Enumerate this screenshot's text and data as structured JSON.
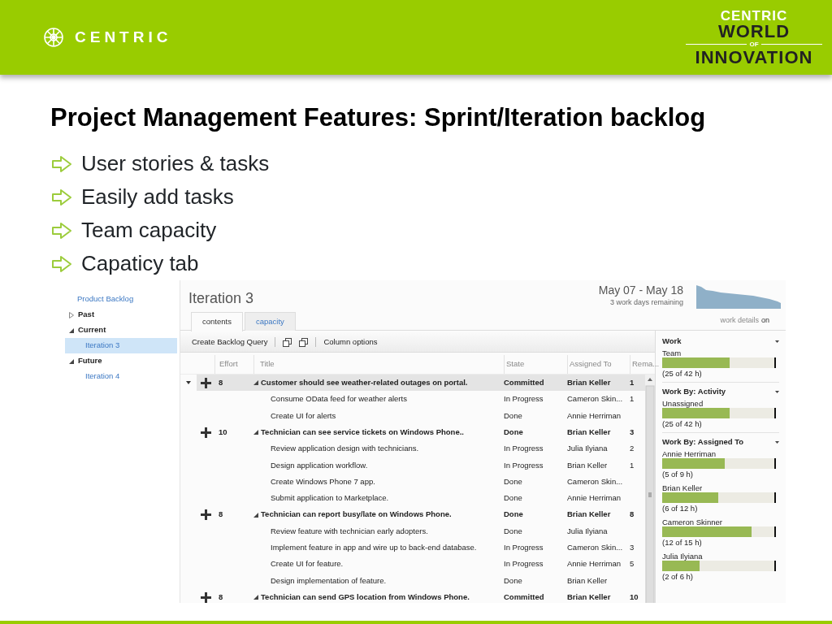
{
  "header": {
    "logo_text": "CENTRIC",
    "badge": {
      "top": "CENTRIC",
      "middle": "WORLD",
      "small": "OF",
      "bottom": "INNOVATION"
    }
  },
  "title": "Project Management Features: Sprint/Iteration backlog",
  "bullets": [
    "User stories & tasks",
    "Easily add tasks",
    "Team capacity",
    "Capaticy tab"
  ],
  "app": {
    "nav": [
      {
        "kind": "link",
        "label": "Product Backlog",
        "selected": false
      },
      {
        "kind": "group",
        "label": "Past",
        "expanded": false,
        "selected": false
      },
      {
        "kind": "group",
        "label": "Current",
        "expanded": true,
        "selected": false,
        "children": [
          {
            "label": "Iteration 3",
            "selected": true
          }
        ]
      },
      {
        "kind": "group",
        "label": "Future",
        "expanded": true,
        "selected": false,
        "children": [
          {
            "label": "Iteration 4",
            "selected": false
          }
        ]
      }
    ],
    "iteration": {
      "name": "Iteration 3",
      "dates": "May 07 - May 18",
      "days_remaining": "3 work days remaining"
    },
    "tabs": [
      {
        "label": "contents",
        "selected": true
      },
      {
        "label": "capacity",
        "selected": false
      }
    ],
    "work_details": {
      "label": "work details",
      "value": "on"
    },
    "toolbar": [
      {
        "kind": "text",
        "label": "Create Backlog Query"
      },
      {
        "kind": "separator"
      },
      {
        "kind": "icon"
      },
      {
        "kind": "icon"
      },
      {
        "kind": "separator"
      },
      {
        "kind": "text",
        "label": "Column options"
      }
    ],
    "table": {
      "columns": [
        "Effort",
        "Title",
        "State",
        "Assigned To",
        "Rema..."
      ],
      "rows": [
        {
          "kind": "story",
          "selected": true,
          "expanded": true,
          "effort": "8",
          "title": "Customer should see weather-related outages on portal.",
          "state": "Committed",
          "assigned_to": "Brian Keller",
          "remaining": "1"
        },
        {
          "kind": "task",
          "selected": false,
          "title": "Consume OData feed for weather alerts",
          "state": "In Progress",
          "assigned_to": "Cameron Skin...",
          "remaining": "1"
        },
        {
          "kind": "task",
          "selected": false,
          "title": "Create UI for alerts",
          "state": "Done",
          "assigned_to": "Annie Herriman"
        },
        {
          "kind": "story",
          "selected": false,
          "expanded": true,
          "effort": "10",
          "title": "Technician can see service tickets on Windows Phone..",
          "state": "Done",
          "assigned_to": "Brian Keller",
          "remaining": "3"
        },
        {
          "kind": "task",
          "selected": false,
          "title": "Review application design with technicians.",
          "state": "In Progress",
          "assigned_to": "Julia Ilyiana",
          "remaining": "2"
        },
        {
          "kind": "task",
          "selected": false,
          "title": "Design application workflow.",
          "state": "In Progress",
          "assigned_to": "Brian Keller",
          "remaining": "1"
        },
        {
          "kind": "task",
          "selected": false,
          "title": "Create Windows Phone 7 app.",
          "state": "Done",
          "assigned_to": "Cameron Skin..."
        },
        {
          "kind": "task",
          "selected": false,
          "title": "Submit application to Marketplace.",
          "state": "Done",
          "assigned_to": "Annie Herriman"
        },
        {
          "kind": "story",
          "selected": false,
          "expanded": true,
          "effort": "8",
          "title": "Technician can report busy/late on Windows Phone.",
          "state": "Done",
          "assigned_to": "Brian Keller",
          "remaining": "8"
        },
        {
          "kind": "task",
          "selected": false,
          "title": "Review feature with technician early adopters.",
          "state": "Done",
          "assigned_to": "Julia Ilyiana"
        },
        {
          "kind": "task",
          "selected": false,
          "title": "Implement feature in app and wire up to back-end database.",
          "state": "In Progress",
          "assigned_to": "Cameron Skin...",
          "remaining": "3"
        },
        {
          "kind": "task",
          "selected": false,
          "title": "Create UI for feature.",
          "state": "In Progress",
          "assigned_to": "Annie Herriman",
          "remaining": "5"
        },
        {
          "kind": "task",
          "selected": false,
          "title": "Design implementation of feature.",
          "state": "Done",
          "assigned_to": "Brian Keller"
        },
        {
          "kind": "story",
          "selected": false,
          "expanded": true,
          "effort": "8",
          "title": "Technician can send GPS location from Windows Phone.",
          "state": "Committed",
          "assigned_to": "Brian Keller",
          "remaining": "10"
        }
      ]
    },
    "capacity": {
      "sections": [
        {
          "title": "Work",
          "items": [
            {
              "name": "Team",
              "level": 0.6,
              "reading": "(25 of 42 h)"
            }
          ]
        },
        {
          "title": "Work By: Activity",
          "items": [
            {
              "name": "Unassigned",
              "level": 0.6,
              "reading": "(25 of 42 h)"
            }
          ]
        },
        {
          "title": "Work By: Assigned To",
          "items": [
            {
              "name": "Annie Herriman",
              "level": 0.56,
              "reading": "(5 of 9 h)"
            },
            {
              "name": "Brian Keller",
              "level": 0.5,
              "reading": "(6 of 12 h)"
            },
            {
              "name": "Cameron Skinner",
              "level": 0.8,
              "reading": "(12 of 15 h)"
            },
            {
              "name": "Julia Ilyiana",
              "level": 0.33,
              "reading": "(2 of 6 h)"
            }
          ]
        }
      ]
    }
  }
}
